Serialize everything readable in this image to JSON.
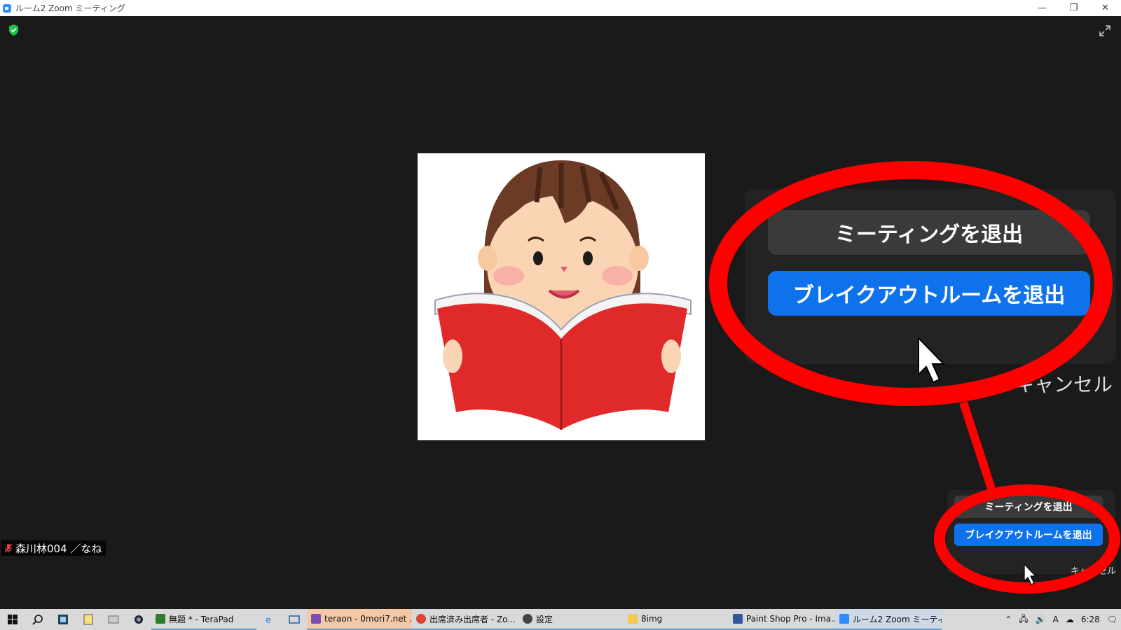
{
  "window": {
    "title": "ルーム2  Zoom ミーティング",
    "controls": [
      "—",
      "❐",
      "✕"
    ]
  },
  "participant": {
    "name": "森川林004 ／なね",
    "mic_status": "muted"
  },
  "popup_zoomed": {
    "leave_meeting": "ミーティングを退出",
    "leave_breakout": "ブレイクアウトルームを退出",
    "cancel": "キャンセル"
  },
  "popup_small": {
    "leave_meeting": "ミーティングを退出",
    "leave_breakout": "ブレイクアウトルームを退出",
    "cancel": "キャンセル"
  },
  "colors": {
    "accent_blue": "#0e72ed",
    "highlight_red": "#ff0000",
    "background": "#1a1a1a"
  },
  "taskbar": {
    "tasks": [
      {
        "label": "無題 * - TeraPad",
        "icon": "terapad-icon",
        "color": "#2d7d2d"
      },
      {
        "label": "teraon - 0mori7.net ...",
        "icon": "app-icon",
        "color": "#7a4fb0",
        "highlight": true
      },
      {
        "label": "出席済み出席者 - Zo...",
        "icon": "chrome-icon",
        "color": "#db4437"
      },
      {
        "label": "設定",
        "icon": "gear-icon",
        "color": "#444444"
      },
      {
        "label": "8img",
        "icon": "folder-icon",
        "color": "#f2c94c"
      },
      {
        "label": "Paint Shop Pro - Ima...",
        "icon": "paint-icon",
        "color": "#335599"
      },
      {
        "label": "ルーム2  Zoom ミーティ...",
        "icon": "zoom-icon",
        "color": "#2d8cff"
      }
    ],
    "clock": "6:28",
    "ime": "A"
  }
}
